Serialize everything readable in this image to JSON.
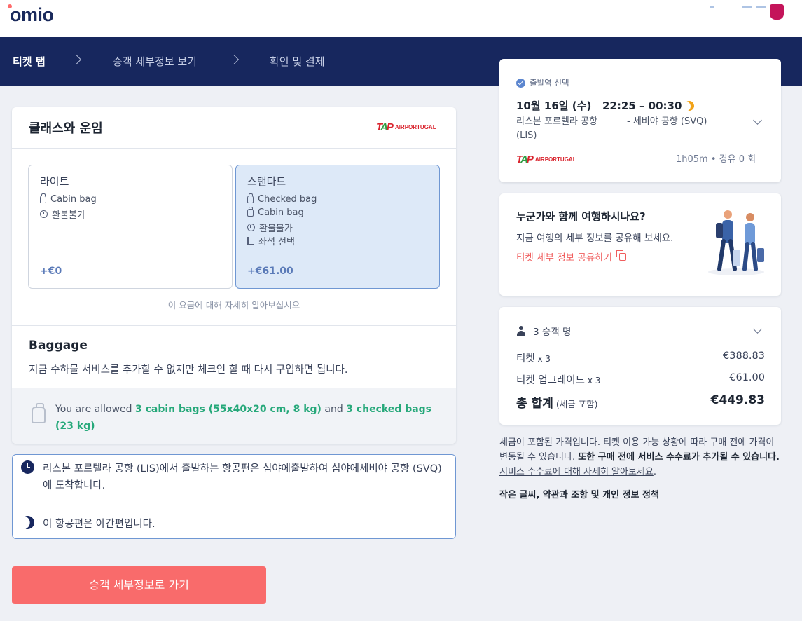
{
  "header": {
    "logo": "omio",
    "steps": [
      "티켓 탭",
      "승객 세부정보 보기",
      "확인 및 결제"
    ]
  },
  "fare_card": {
    "title": "클래스와 운임",
    "airline_logo_text": "AIRPORTUGAL",
    "fares": [
      {
        "name": "라이트",
        "features": [
          "Cabin bag",
          "환불불가"
        ],
        "feature_icons": [
          "bag-icon",
          "info-circle-icon"
        ],
        "price": "+€0",
        "selected": false
      },
      {
        "name": "스탠다드",
        "features": [
          "Checked bag",
          "Cabin bag",
          "환불불가",
          "좌석 선택"
        ],
        "feature_icons": [
          "checked-bag-icon",
          "bag-icon",
          "info-circle-icon",
          "seat-icon"
        ],
        "price": "+€61.00",
        "selected": true
      }
    ],
    "learn_more": "이 요금에 대해 자세히 알아보십시오"
  },
  "baggage": {
    "title": "Baggage",
    "description": "지금 수하물 서비스를 추가할 수 없지만 체크인 할 때 다시 구입하면 됩니다.",
    "allowance_prefix": "You are allowed ",
    "cabin": "3 cabin bags (55x40x20 cm, 8 kg)",
    "allowance_mid": " and ",
    "checked": "3 checked bags (23 kg)"
  },
  "info": {
    "departure_note": "리스본 포르텔라 공항 (LIS)에서 출발하는 항공편은 심야에출발하여 심야에세비야 공항 (SVQ)에 도착합니다.",
    "night_note": "이 항공편은 야간편입니다."
  },
  "cta_label": "승객 세부정보로 가기",
  "trip": {
    "label": "출발역 선택",
    "date": "10월 16일 (수)",
    "time": "22:25 – 00:30",
    "origin_line1": "리스본 포르텔라 공항",
    "origin_line2": "(LIS)",
    "destination": "-  세비야 공항 (SVQ)",
    "duration": "1h05m • 경유 0 회"
  },
  "share": {
    "title": "누군가와 함께 여행하시나요?",
    "description": "지금 여행의 세부 정보를 공유해 보세요.",
    "link": "티켓 세부 정보 공유하기"
  },
  "summary": {
    "passengers": "3 승객 명",
    "rows": [
      {
        "label": "티켓",
        "qty": " x 3",
        "value": "€388.83"
      },
      {
        "label": "티켓 업그레이드",
        "qty": " x 3",
        "value": "€61.00"
      }
    ],
    "total_label": "총 합계",
    "total_note": " (세금 포함)",
    "total_value": "€449.83"
  },
  "note": {
    "text1": "세금이 포함된 가격입니다. 티켓 이용 가능 상황에 따라 구매 전에 가격이 변동될 수 있습니다. ",
    "bold": "또한 구매 전에 서비스 수수료가 추가될 수 있습니다.",
    "link": "서비스 수수료에 대해 자세히 알아보세요",
    "end": "."
  },
  "fine_print": "작은 글씨, 약관과 조항 및 개인 정보 정책",
  "colors": {
    "navy": "#17275e",
    "coral": "#f96b6b",
    "green": "#26a87a",
    "selected_fare": "#dde9f8"
  }
}
